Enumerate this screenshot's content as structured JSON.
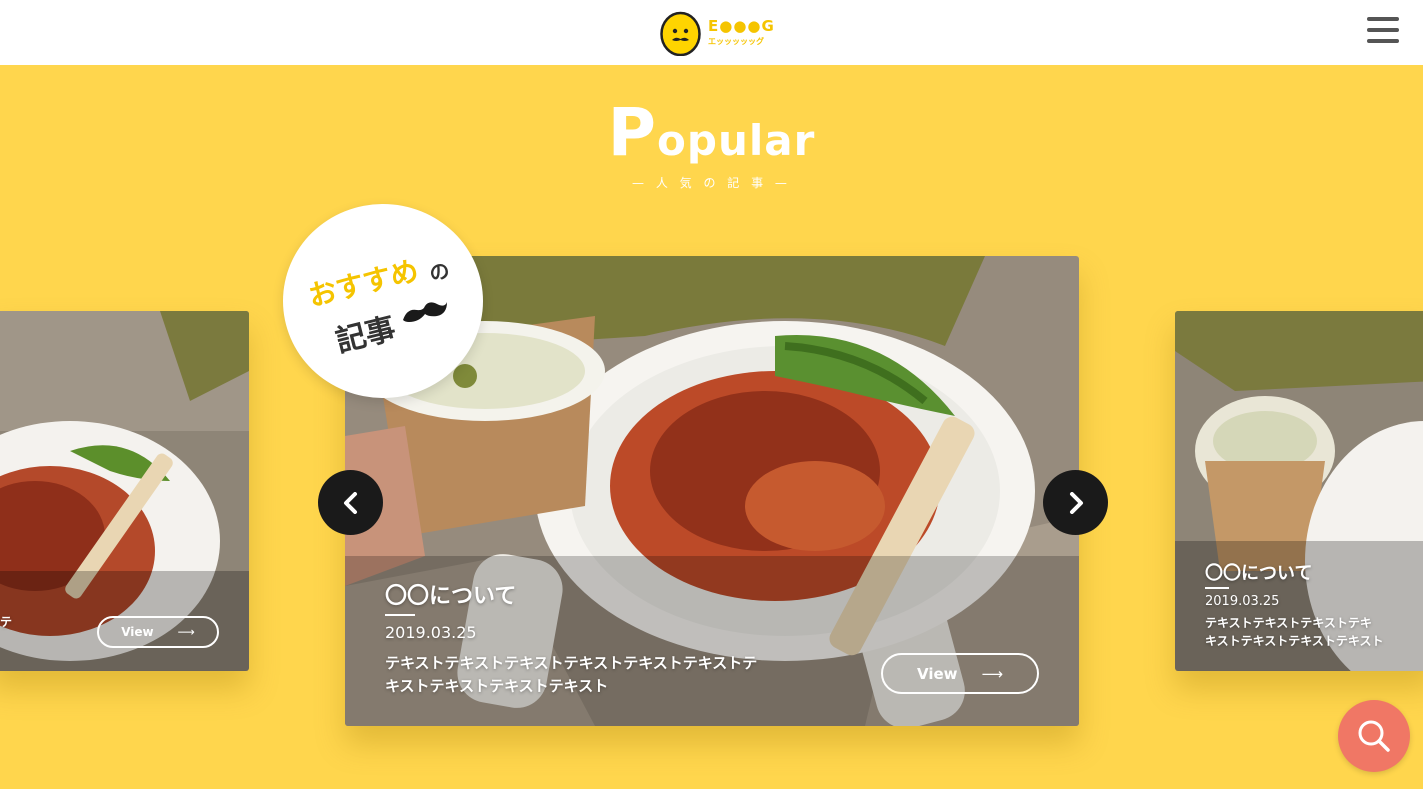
{
  "header": {
    "logo_text": "E●●●G",
    "logo_sub": "エッッッッッグ",
    "menu_icon": "hamburger-icon"
  },
  "section": {
    "title_first": "P",
    "title_rest": "opular",
    "subtitle": "— 人 気 の 記 事 —"
  },
  "badge": {
    "line1": "おすすめ",
    "particle": "の",
    "line2": "記事",
    "icon": "mustache-icon"
  },
  "cards": [
    {
      "position": "left",
      "title": "",
      "date": "",
      "text": "テ",
      "view_label": "View",
      "view_icon": "long-arrow-right-icon"
    },
    {
      "position": "center",
      "title": "〇〇について",
      "date": "2019.03.25",
      "text_line1": "テキストテキストテキストテキストテキストテキストテ",
      "text_line2": "キストテキストテキストテキスト",
      "view_label": "View",
      "view_icon": "long-arrow-right-icon"
    },
    {
      "position": "right",
      "title": "〇〇について",
      "date": "2019.03.25",
      "text_line1": "テキストテキストテキストテキ",
      "text_line2": "キストテキストテキストテキスト"
    }
  ],
  "nav": {
    "prev_icon": "chevron-left-icon",
    "next_icon": "chevron-right-icon"
  },
  "search": {
    "icon": "search-icon"
  },
  "colors": {
    "background": "#ffd64d",
    "accent_yellow": "#f5c400",
    "search_button": "#f07765",
    "nav_button": "#1a1a1a"
  }
}
